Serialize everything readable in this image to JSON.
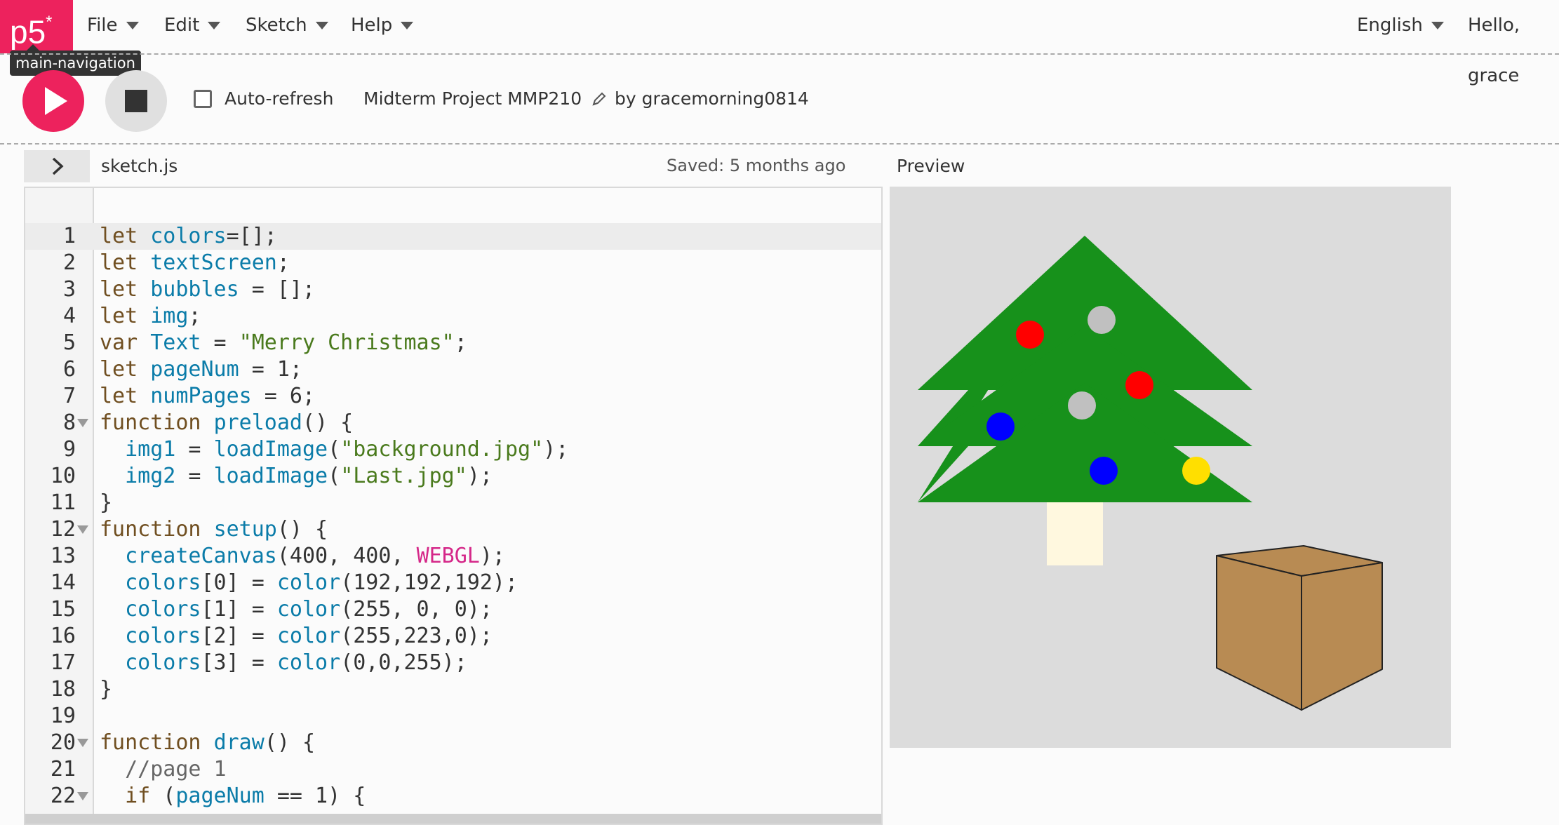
{
  "nav": {
    "logo": "p5",
    "logo_sup": "*",
    "menus": [
      "File",
      "Edit",
      "Sketch",
      "Help"
    ],
    "language": "English",
    "greeting": "Hello, grace",
    "tooltip": "main-navigation"
  },
  "toolbar": {
    "auto_refresh_label": "Auto-refresh",
    "auto_refresh_checked": false,
    "project_name": "Midterm Project MMP210",
    "author": "by gracemorning0814"
  },
  "editor": {
    "filename": "sketch.js",
    "saved_status": "Saved: 5 months ago",
    "lines": [
      "1",
      "2",
      "3",
      "4",
      "5",
      "6",
      "7",
      "8",
      "9",
      "10",
      "11",
      "12",
      "13",
      "14",
      "15",
      "16",
      "17",
      "18",
      "19",
      "20",
      "21",
      "22"
    ]
  },
  "preview": {
    "label": "Preview",
    "ornament_colors": {
      "gray": "#c0c0c0",
      "red": "#ff0000",
      "yellow": "#ffdf00",
      "blue": "#0000ff"
    },
    "tree_color": "#17911b",
    "trunk_color": "#fff8df",
    "box_color": "#b88b53",
    "background": "#dcdcdc"
  },
  "colors": {
    "accent": "#ed225d"
  }
}
